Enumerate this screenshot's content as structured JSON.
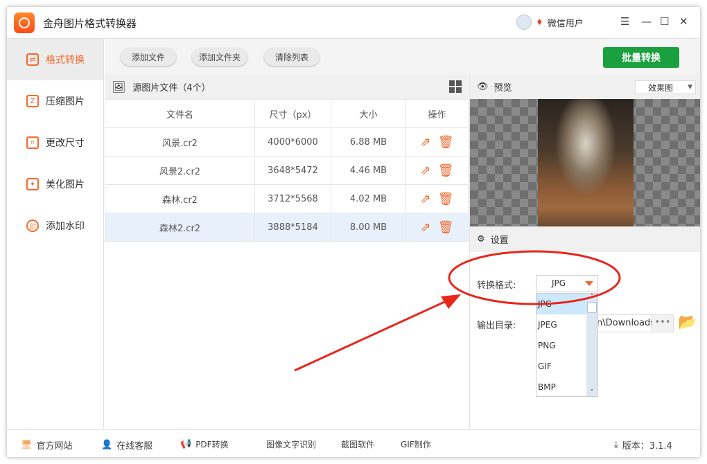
{
  "app": {
    "title": "金舟图片格式转换器",
    "user": "微信用户"
  },
  "sidebar": {
    "items": [
      {
        "label": "格式转换",
        "icon": "⇄"
      },
      {
        "label": "压缩图片",
        "icon": "Z"
      },
      {
        "label": "更改尺寸",
        "icon": "⌗"
      },
      {
        "label": "美化图片",
        "icon": "✦"
      },
      {
        "label": "添加水印",
        "icon": "印"
      }
    ]
  },
  "toolbar": {
    "add_file": "添加文件",
    "add_folder": "添加文件夹",
    "clear_list": "清除列表",
    "batch_convert": "批量转换"
  },
  "file_list": {
    "title": "源图片文件（4个）",
    "columns": [
      "文件名",
      "尺寸（px）",
      "大小",
      "操作"
    ],
    "rows": [
      {
        "name": "风景.cr2",
        "size": "4000*6000",
        "filesize": "6.88 MB"
      },
      {
        "name": "风景2.cr2",
        "size": "3648*5472",
        "filesize": "4.46 MB"
      },
      {
        "name": "森林.cr2",
        "size": "3712*5568",
        "filesize": "4.02 MB"
      },
      {
        "name": "森林2.cr2",
        "size": "3888*5184",
        "filesize": "8.00 MB",
        "selected": true
      }
    ]
  },
  "preview": {
    "title": "预览",
    "mode": "效果图"
  },
  "settings": {
    "title": "设置",
    "format_label": "转换格式:",
    "format_value": "JPG",
    "format_options": [
      "JPG",
      "JPEG",
      "PNG",
      "GIF",
      "BMP"
    ],
    "output_label": "输出目录:",
    "output_value": "n\\Downloads",
    "browse": "•••"
  },
  "footer": {
    "website": "官方网站",
    "support": "在线客服",
    "links": [
      "PDF转换",
      "图像文字识别",
      "截图软件",
      "GIF制作"
    ],
    "version": "版本：3.1.4"
  },
  "colors": {
    "accent": "#f26a2e",
    "primary_button": "#1aa03e",
    "annotation": "#e8261c"
  }
}
